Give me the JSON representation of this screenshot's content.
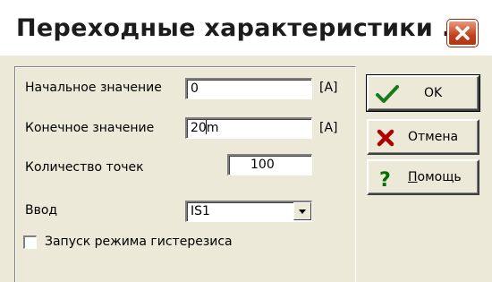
{
  "dialog": {
    "title": "Переходные характеристики ...",
    "close_icon": "close-icon"
  },
  "form": {
    "start_label": "Начальное значение",
    "start_value": "0",
    "start_unit": "[A]",
    "end_label": "Конечное значение",
    "end_value_before_caret": "20",
    "end_value_after_caret": "m",
    "end_unit": "[A]",
    "points_label": "Количество точек",
    "points_value": "100",
    "input_label": "Ввод",
    "input_value": "IS1",
    "hysteresis_label": "Запуск режима гистерезиса",
    "hysteresis_checked": false
  },
  "buttons": {
    "ok_label": "OK",
    "ok_icon": "checkmark-icon",
    "cancel_label": "Отмена",
    "cancel_icon": "cross-icon",
    "help_label_mnemonic": "П",
    "help_label_rest": "омощь",
    "help_icon": "question-icon"
  },
  "colors": {
    "dialog_bg": "#ece9d8",
    "close_red": "#c2401d",
    "ok_green": "#1a7a1a",
    "cancel_red": "#b00000",
    "help_green": "#007000"
  }
}
